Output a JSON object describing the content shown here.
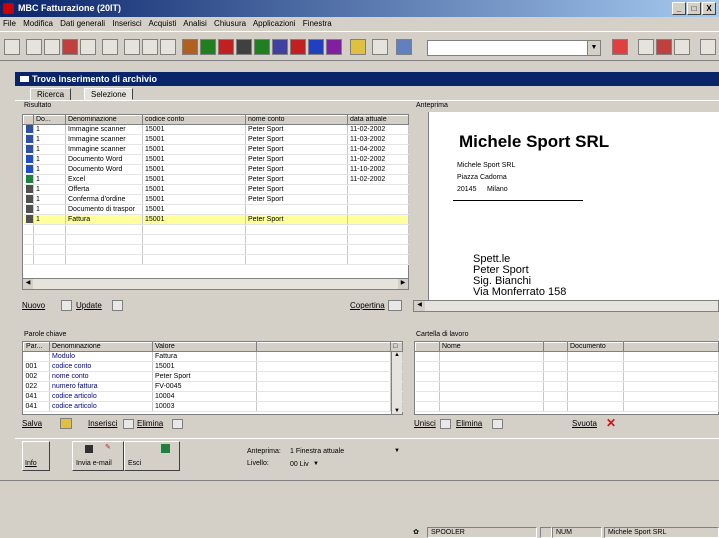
{
  "window": {
    "title": "MBC Fatturazione (20IT)",
    "minimize": "_",
    "maximize": "□",
    "close": "X"
  },
  "menu": [
    "File",
    "Modifica",
    "Dati generali",
    "Inserisci",
    "Acquisti",
    "Analisi",
    "Chiusura",
    "Applicazioni",
    "Finestra"
  ],
  "subwindow": {
    "title": "Trova inserimento di archivio"
  },
  "tabs": [
    "Ricerca",
    "Selezione"
  ],
  "results": {
    "group_label": "Risultato",
    "columns": [
      "Do...",
      "Denominazione",
      "codice conto",
      "nome conto",
      "data attuale"
    ],
    "rows": [
      {
        "icon": "scanner-image-icon",
        "do": "1",
        "name": "Immagine scanner",
        "code": "15001",
        "account": "Peter Sport",
        "date": "11-02-2002"
      },
      {
        "icon": "scanner-image-icon",
        "do": "1",
        "name": "Immagine scanner",
        "code": "15001",
        "account": "Peter Sport",
        "date": "11-03-2002"
      },
      {
        "icon": "scanner-image-icon",
        "do": "1",
        "name": "Immagine scanner",
        "code": "15001",
        "account": "Peter Sport",
        "date": "11-04-2002"
      },
      {
        "icon": "word-document-icon",
        "do": "1",
        "name": "Documento Word",
        "code": "15001",
        "account": "Peter Sport",
        "date": "11-02-2002"
      },
      {
        "icon": "word-document-icon",
        "do": "1",
        "name": "Documento Word",
        "code": "15001",
        "account": "Peter Sport",
        "date": "11-10-2002"
      },
      {
        "icon": "excel-icon",
        "do": "1",
        "name": "Excel",
        "code": "15001",
        "account": "Peter Sport",
        "date": "11-02-2002"
      },
      {
        "icon": "document-icon",
        "do": "1",
        "name": "Offerta",
        "code": "15001",
        "account": "Peter Sport",
        "date": ""
      },
      {
        "icon": "document-icon",
        "do": "1",
        "name": "Conferma d'ordine",
        "code": "15001",
        "account": "Peter Sport",
        "date": ""
      },
      {
        "icon": "document-icon",
        "do": "1",
        "name": "Documento di traspor",
        "code": "15001",
        "account": "",
        "date": ""
      },
      {
        "icon": "document-icon",
        "do": "1",
        "name": "Fattura",
        "code": "15001",
        "account": "Peter Sport",
        "date": ""
      }
    ],
    "buttons": {
      "new": "Nuovo",
      "update": "Update",
      "cover": "Copertina"
    }
  },
  "preview": {
    "group_label": "Anteprima",
    "company": "Michele Sport SRL",
    "sender_name": "Michele Sport SRL",
    "sender_street": "Piazza Cadorna",
    "sender_zip": "20145",
    "sender_city": "Milano",
    "recipient": [
      "Spett.le",
      "Peter Sport",
      "Sig. Bianchi",
      "Via Monferrato 158"
    ]
  },
  "keywords": {
    "group_label": "Parole chiave",
    "columns": [
      "Par...",
      "Denominazione",
      "Valore"
    ],
    "rows": [
      {
        "par": "",
        "name": "Modulo",
        "value": "Fattura"
      },
      {
        "par": "001",
        "name": "codice conto",
        "value": "15001"
      },
      {
        "par": "002",
        "name": "nome conto",
        "value": "Peter Sport"
      },
      {
        "par": "022",
        "name": "numero fattura",
        "value": "FV-0045"
      },
      {
        "par": "041",
        "name": "codice articolo",
        "value": "10004"
      },
      {
        "par": "041",
        "name": "codice articolo",
        "value": "10003"
      }
    ],
    "buttons": {
      "save": "Salva",
      "insert": "Inserisci",
      "delete": "Elimina"
    }
  },
  "workfolder": {
    "group_label": "Cartella di lavoro",
    "columns": [
      "Nome",
      "Documento"
    ],
    "buttons": {
      "merge": "Unisci",
      "delete": "Elimina",
      "empty": "Svuota"
    }
  },
  "actions": {
    "info": "Info",
    "send_email": "Invia e-mail",
    "exit": "Esci"
  },
  "options": {
    "preview_label": "Anteprima:",
    "preview_value": "1 Finestra attuale",
    "level_label": "Livello:",
    "level_value": "00 Liv"
  },
  "statusbar": {
    "spooler": "SPOOLER",
    "num": "NUM",
    "company": "Michele Sport SRL"
  }
}
